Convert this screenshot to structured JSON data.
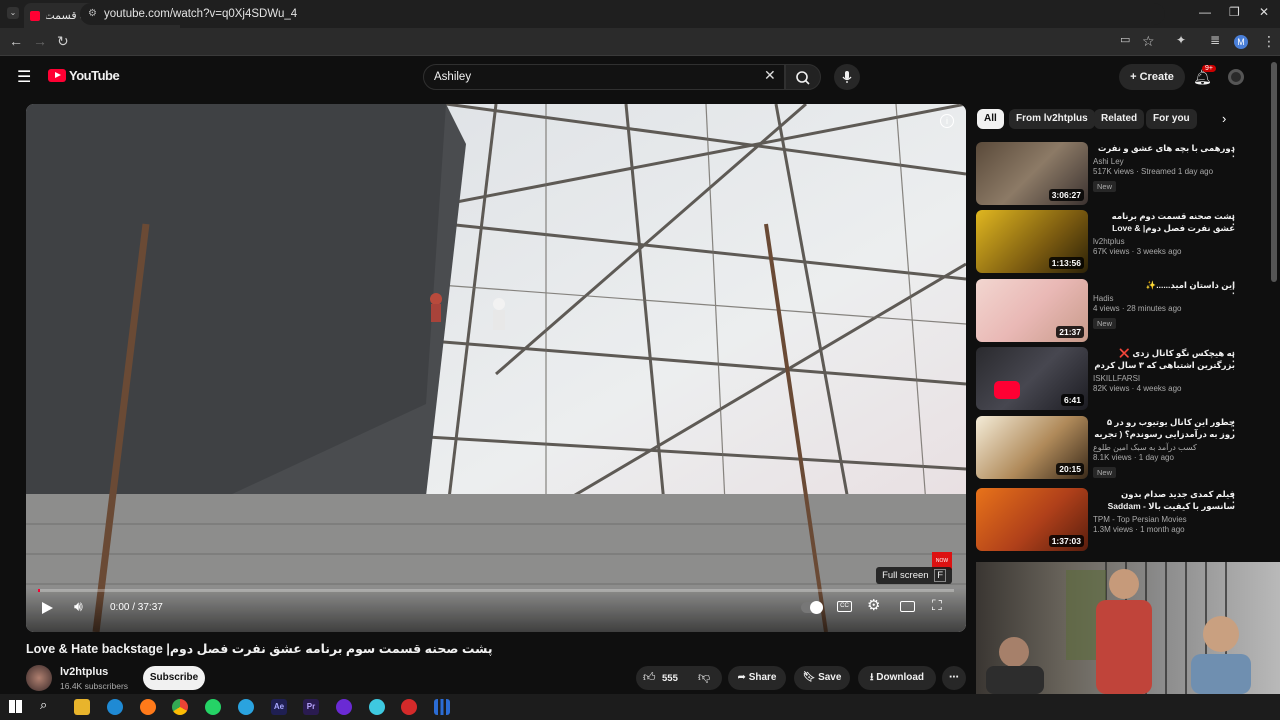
{
  "browser": {
    "tab_title": "(125) پشت صحنه قسمت سوم بر...",
    "url": "youtube.com/watch?v=q0Xj4SDWu_4"
  },
  "youtube": {
    "logo": "YouTube",
    "search_value": "Ashiley",
    "create_label": "Create",
    "notif_count": "9+",
    "avatar_letter": "M"
  },
  "player": {
    "time": "0:00 / 37:37",
    "fullscreen_tip": "Full screen",
    "fullscreen_key": "F",
    "progress": 0.0
  },
  "video": {
    "title": "پشت صحنه قسمت سوم برنامه عشق نفرت فصل دوم| Love & Hate backstage",
    "channel": "lv2htplus",
    "subscribers": "16.4K subscribers",
    "subscribe_label": "Subscribe",
    "likes": "555",
    "share_label": "Share",
    "save_label": "Save",
    "download_label": "Download"
  },
  "chips": [
    "All",
    "From lv2htplus",
    "Related",
    "For you"
  ],
  "recommendations": [
    {
      "title": "دورهمی با بچه های عشق و نفرت",
      "channel": "Ashi Ley",
      "views": "517K views · Streamed 1 day ago",
      "new": "New",
      "duration": "3:06:27"
    },
    {
      "title": "پشت صحنه قسمت دوم برنامه عشق نفرت فصل دوم| Love & Hate backstage",
      "channel": "lv2htplus",
      "views": "67K views · 3 weeks ago",
      "new": "",
      "duration": "1:13:56"
    },
    {
      "title": "این داستان امید......✨",
      "channel": "Hadis",
      "views": "4 views · 28 minutes ago",
      "new": "New",
      "duration": "21:37"
    },
    {
      "title": "به هیچکس نگو کانال زدی ❌ بزرگترین اشتباهی که ۳ سال کردم و ۲ سال عمرم رفت",
      "channel": "ISKILLFARSI",
      "views": "82K views · 4 weeks ago",
      "new": "",
      "duration": "6:41"
    },
    {
      "title": "چطور این کانال یوتیوب رو در ۵ روز به درآمدزایی رسوندم؟ ( تجربه واقعی از ... )",
      "channel": "کسب درآمد به سبک امین طلوع",
      "views": "8.1K views · 1 day ago",
      "new": "New",
      "duration": "20:15"
    },
    {
      "title": "فیلم کمدی جدید صدام بدون سانسور با کیفیت بالا - Saddam Full Movie",
      "channel": "TPM - Top Persian Movies",
      "views": "1.3M views · 1 month ago",
      "new": "",
      "duration": "1:37:03"
    }
  ],
  "colors": {
    "accent": "#ff0033",
    "background": "#0f0f0f",
    "chip": "#272727"
  }
}
